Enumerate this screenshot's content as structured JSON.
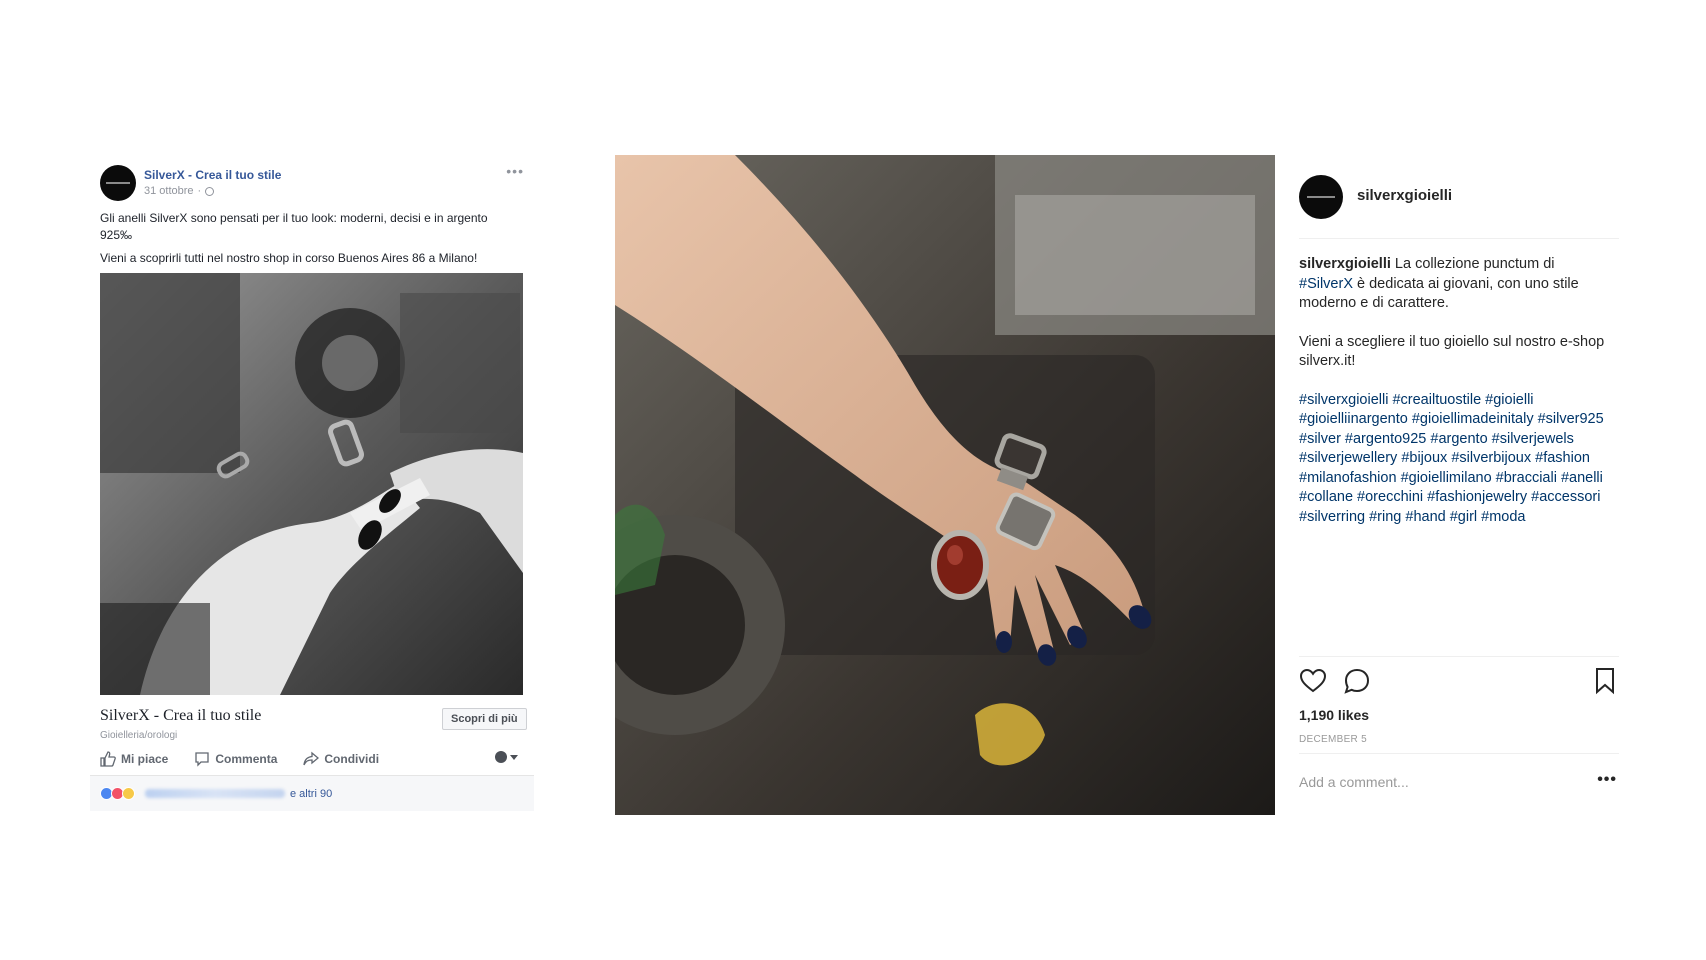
{
  "facebook_post": {
    "page_name": "SilverX - Crea il tuo stile",
    "date": "31 ottobre",
    "date_separator": "·",
    "options_icon": "ellipsis-icon",
    "text_line_1": "Gli anelli SilverX sono pensati per il tuo look: moderni, decisi e in argento 925‰",
    "text_line_2": "Vieni a scoprirli tutti nel nostro shop in corso Buenos Aires 86 a Milano!",
    "link_title": "SilverX - Crea il tuo stile",
    "link_subtitle": "Gioielleria/orologi",
    "cta_label": "Scopri di più",
    "actions": {
      "like": "Mi piace",
      "comment": "Commenta",
      "share": "Condividi"
    },
    "reactions_others": "e altri 90"
  },
  "instagram_post": {
    "username": "silverxgioielli",
    "caption_user": "silverxgioielli",
    "caption_part1": " La collezione punctum di ",
    "caption_tag": "#SilverX",
    "caption_part2": " è dedicata ai giovani, con uno stile moderno e di carattere.",
    "caption_para2": "Vieni a scegliere il tuo gioiello sul nostro e-shop silverx.it!",
    "hashtags": "#silverxgioielli #creailtuostile #gioielli #gioielliinargento #gioiellimadeinitaly #silver925 #silver #argento925 #argento #silverjewels #silverjewellery #bijoux #silverbijoux #fashion #milanofashion #gioiellimilano #bracciali #anelli #collane #orecchini #fashionjewelry #accessori #silverring #ring #hand #girl #moda",
    "likes": "1,190 likes",
    "date": "DECEMBER 5",
    "comment_placeholder": "Add a comment...",
    "more_icon": "ellipsis-icon"
  },
  "colors": {
    "fb_link": "#365899",
    "ig_tag": "#003569",
    "text": "#262626"
  }
}
